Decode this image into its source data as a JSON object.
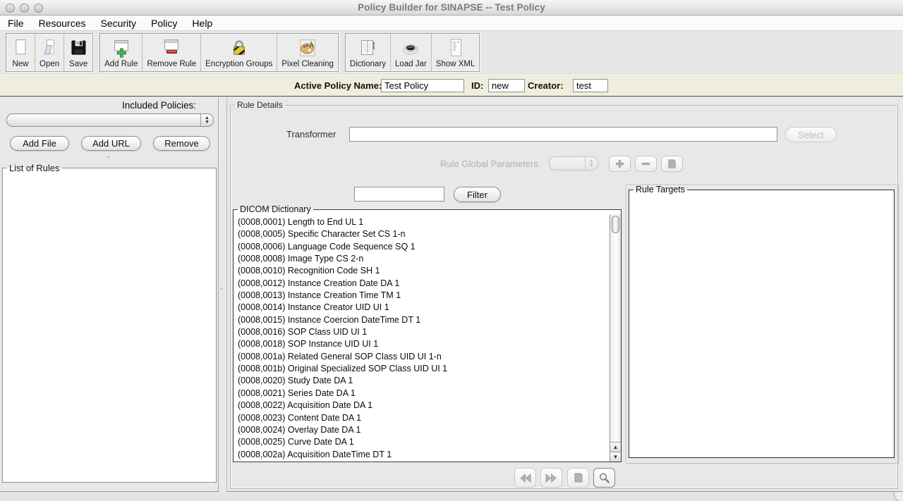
{
  "window": {
    "title": "Policy Builder for SINAPSE -- Test Policy",
    "controls": [
      "close",
      "minimize",
      "zoom"
    ]
  },
  "menu": {
    "items": [
      "File",
      "Resources",
      "Security",
      "Policy",
      "Help"
    ]
  },
  "toolbar": {
    "groups": [
      {
        "buttons": [
          {
            "label": "New",
            "icon": "new-document-icon"
          },
          {
            "label": "Open",
            "icon": "open-folder-icon"
          },
          {
            "label": "Save",
            "icon": "save-floppy-icon"
          }
        ]
      },
      {
        "buttons": [
          {
            "label": "Add Rule",
            "icon": "add-rule-icon"
          },
          {
            "label": "Remove Rule",
            "icon": "remove-rule-icon"
          },
          {
            "label": "Encryption Groups",
            "icon": "padlock-icon"
          },
          {
            "label": "Pixel Cleaning",
            "icon": "palette-icon"
          }
        ]
      },
      {
        "buttons": [
          {
            "label": "Dictionary",
            "icon": "notebook-icon"
          },
          {
            "label": "Load Jar",
            "icon": "coffee-cup-icon"
          },
          {
            "label": "Show XML",
            "icon": "xml-page-icon"
          }
        ]
      }
    ]
  },
  "policy_bar": {
    "name_label": "Active Policy Name:",
    "name_value": "Test Policy",
    "id_label": "ID:",
    "id_value": "new",
    "creator_label": "Creator:",
    "creator_value": "test"
  },
  "left_panel": {
    "included_policies_label": "Included Policies:",
    "combo_value": "",
    "add_file_button": "Add File",
    "add_url_button": "Add URL",
    "remove_button": "Remove",
    "list_of_rules_title": "List of Rules"
  },
  "rule_details": {
    "title": "Rule Details",
    "transformer_label": "Transformer",
    "transformer_value": "",
    "select_button": "Select",
    "global_params_label": "Rule Global Parameters",
    "global_params_combo_value": "",
    "global_params_icons": [
      "plus-icon",
      "minus-icon",
      "page-icon"
    ],
    "filter_value": "",
    "filter_button": "Filter",
    "dicom_dictionary": {
      "title": "DICOM Dictionary",
      "entries": [
        "(0008,0001) Length to End UL 1",
        "(0008,0005) Specific Character Set CS 1-n",
        "(0008,0006) Language Code Sequence SQ 1",
        "(0008,0008) Image Type CS 2-n",
        "(0008,0010) Recognition Code SH 1",
        "(0008,0012) Instance Creation Date DA 1",
        "(0008,0013) Instance Creation Time TM 1",
        "(0008,0014) Instance Creator UID UI 1",
        "(0008,0015) Instance Coercion DateTime DT 1",
        "(0008,0016) SOP Class UID UI 1",
        "(0008,0018) SOP Instance UID UI 1",
        "(0008,001a) Related General SOP Class UID UI 1-n",
        "(0008,001b) Original Specialized SOP Class UID UI 1",
        "(0008,0020) Study Date DA 1",
        "(0008,0021) Series Date DA 1",
        "(0008,0022) Acquisition Date DA 1",
        "(0008,0023) Content Date DA 1",
        "(0008,0024) Overlay Date DA 1",
        "(0008,0025) Curve Date DA 1",
        "(0008,002a) Acquisition DateTime DT 1"
      ]
    },
    "rule_targets_title": "Rule Targets",
    "nav_icons": [
      "rewind-icon",
      "fast-forward-icon",
      "page-icon",
      "magnifier-icon"
    ]
  },
  "colors": {
    "policy_bar_bg": "#efeedd",
    "add_green": "#3fae49",
    "remove_red": "#cc2222",
    "window_bg": "#e8e8e8"
  }
}
